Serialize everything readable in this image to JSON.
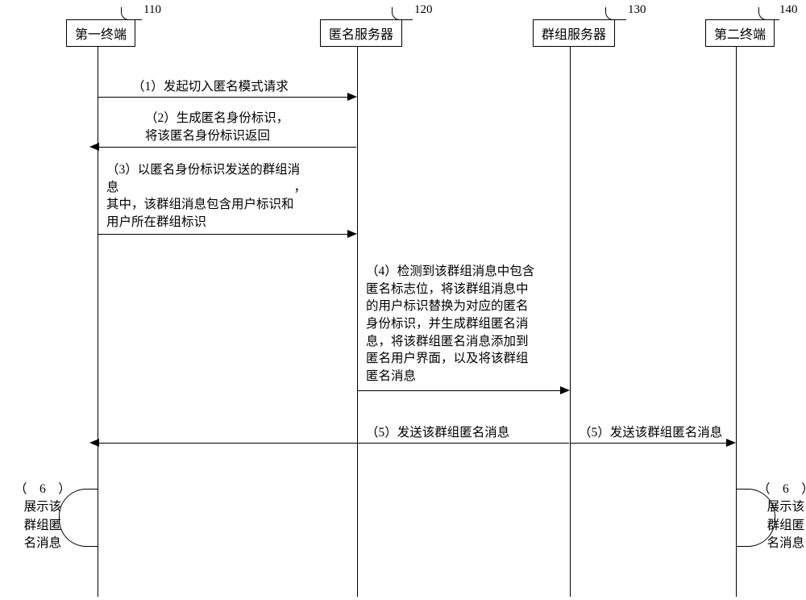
{
  "participants": {
    "p1": {
      "label": "第一终端",
      "ref": "110"
    },
    "p2": {
      "label": "匿名服务器",
      "ref": "120"
    },
    "p3": {
      "label": "群组服务器",
      "ref": "130"
    },
    "p4": {
      "label": "第二终端",
      "ref": "140"
    }
  },
  "messages": {
    "m1": "（1）发起切入匿名模式请求",
    "m2": "（2）生成匿名身份标识，\n将该匿名身份标识返回",
    "m3": "（3）以匿名身份标识发送的群组消\n息　　　　　　　　　　　　　　，\n其中，该群组消息包含用户标识和\n用户所在群组标识",
    "m4": "（4）检测到该群组消息中包含\n匿名标志位，将该群组消息中\n的用户标识替换为对应的匿名\n身份标识，并生成群组匿名消\n息，将该群组匿名消息添加到\n匿名用户界面，以及将该群组\n匿名消息",
    "m5a": "（5）发送该群组匿名消息",
    "m5b": "（5）发送该群组匿名消息",
    "m6a": "（　6　）\n展示该\n群组匿\n名消息",
    "m6b": "（　6　）\n展示该\n群组匿\n名消息"
  }
}
